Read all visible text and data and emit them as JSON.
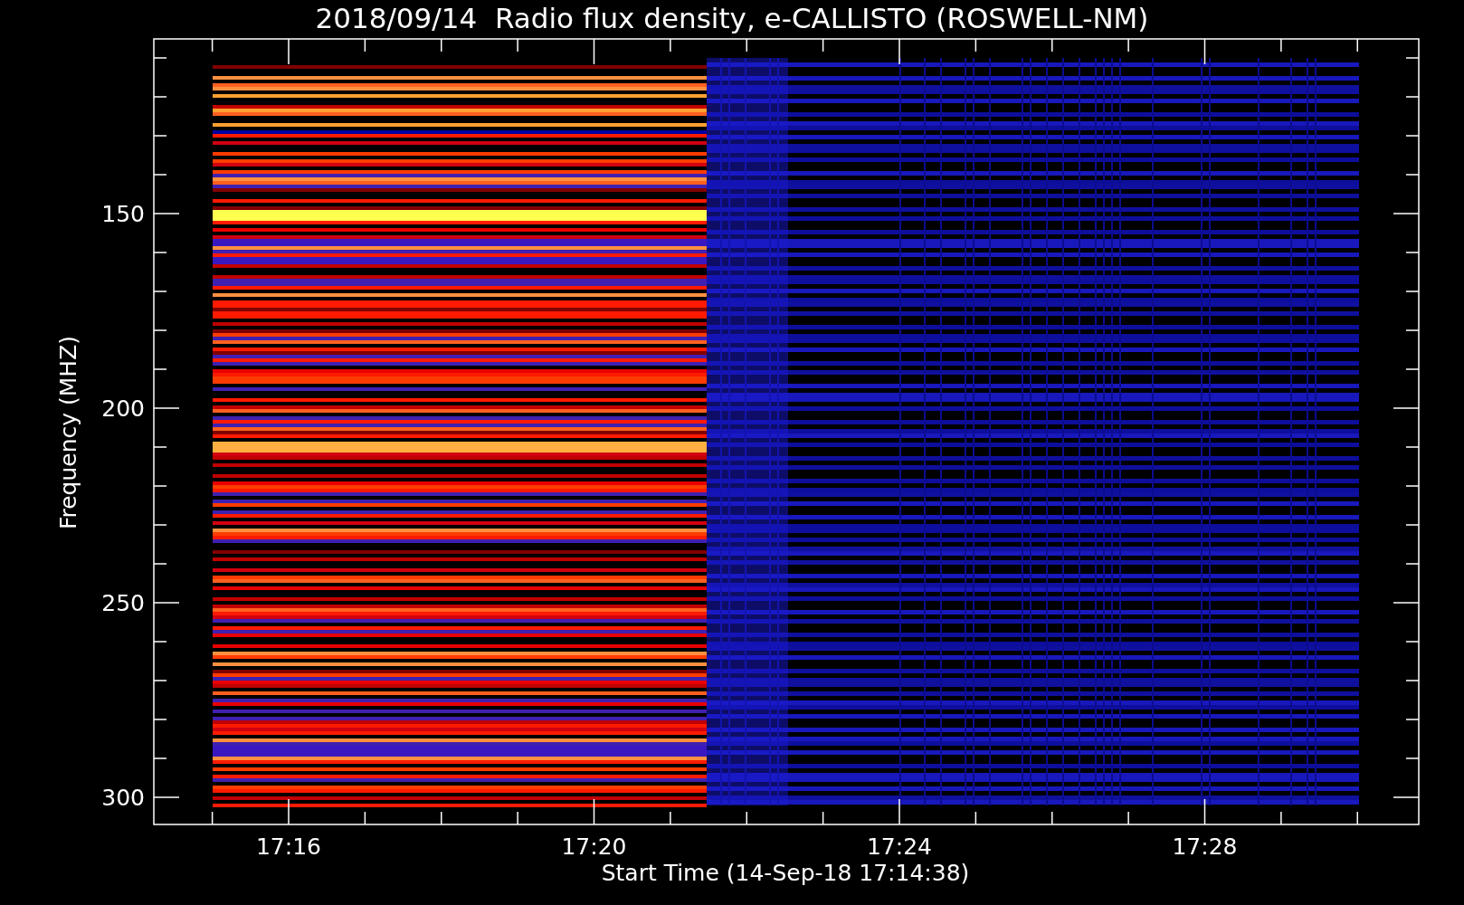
{
  "title": "2018/09/14  Radio flux density, e-CALLISTO (ROSWELL-NM)",
  "y_axis": {
    "label": "Frequency (MHZ)",
    "ticks": [
      "150",
      "200",
      "250",
      "300"
    ]
  },
  "x_axis": {
    "label": "Start Time (14-Sep-18 17:14:38)",
    "ticks": [
      "17:16",
      "17:20",
      "17:24",
      "17:28"
    ]
  }
}
